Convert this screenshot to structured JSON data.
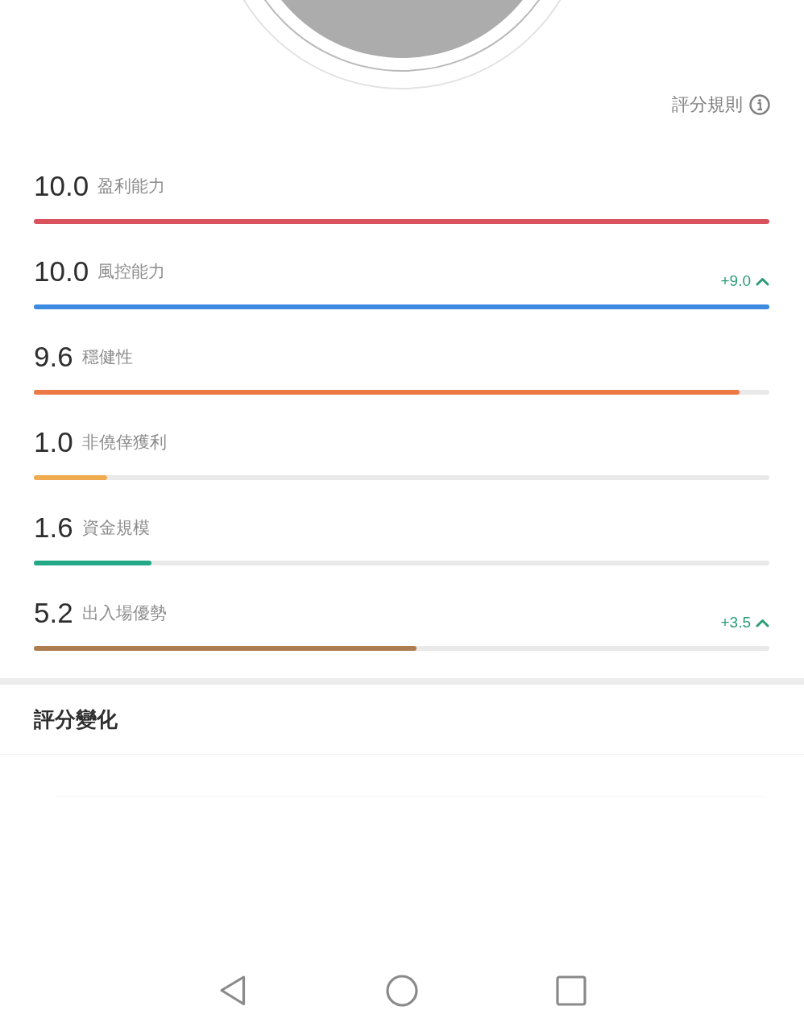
{
  "header": {
    "rules_link": "評分規則"
  },
  "metrics": [
    {
      "score": "10.0",
      "label": "盈利能力",
      "level": 1.0,
      "color": "#d9535e"
    },
    {
      "score": "10.0",
      "label": "風控能力",
      "change": "+9.0",
      "level": 1.0,
      "color": "#3d8be0"
    },
    {
      "score": "9.6",
      "label": "穩健性",
      "level": 0.96,
      "color": "#ec7846"
    },
    {
      "score": "1.0",
      "label": "非僥倖獲利",
      "level": 0.1,
      "color": "#f0ab4e"
    },
    {
      "score": "1.6",
      "label": "資金規模",
      "level": 0.16,
      "color": "#22a887"
    },
    {
      "score": "5.2",
      "label": "出入場優勢",
      "change": "+3.5",
      "level": 0.52,
      "color": "#ad7c50"
    }
  ],
  "score_history": {
    "title": "評分變化"
  }
}
